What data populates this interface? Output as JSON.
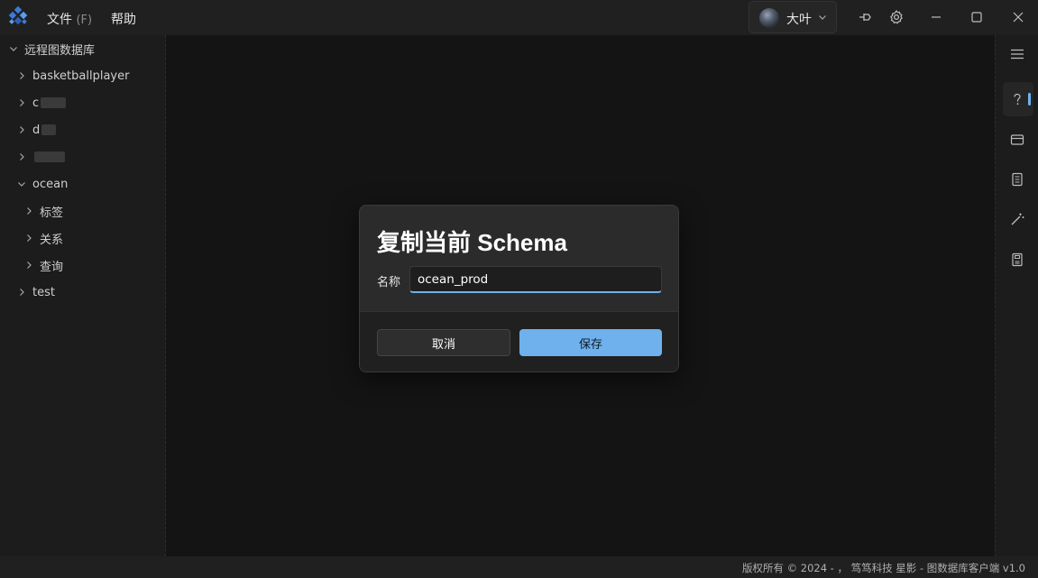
{
  "titlebar": {
    "menu": [
      {
        "label": "文件",
        "hint": "(F)"
      },
      {
        "label": "帮助",
        "hint": ""
      }
    ],
    "user": {
      "name": "大叶"
    }
  },
  "sidebar": {
    "root": {
      "label": "远程图数据库",
      "expanded": true
    },
    "items": [
      {
        "label": "basketballplayer",
        "masked": false
      },
      {
        "label": "c",
        "masked": true
      },
      {
        "label": "d",
        "masked": true
      },
      {
        "label": "",
        "masked": true
      },
      {
        "label": "ocean",
        "expanded": true,
        "children": [
          "标签",
          "关系",
          "查询"
        ]
      },
      {
        "label": "test",
        "masked": false
      }
    ]
  },
  "dialog": {
    "title": "复制当前 Schema",
    "name_label": "名称",
    "name_value": "ocean_prod",
    "cancel_label": "取消",
    "save_label": "保存"
  },
  "statusbar": {
    "text": "版权所有 © 2024 - ， 笃笃科技   星影 - 图数据库客户端  v1.0"
  },
  "colors": {
    "accent": "#6fb1ec",
    "background": "#141414",
    "panel": "#1c1c1c",
    "dialog": "#2b2b2b"
  },
  "rightbar": {
    "icons": [
      "menu-icon",
      "help-icon",
      "card-icon",
      "document-icon",
      "magic-wand-icon",
      "save-disk-icon"
    ],
    "active": "help-icon"
  }
}
